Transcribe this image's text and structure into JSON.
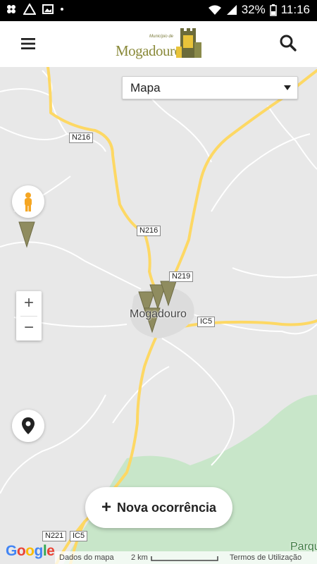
{
  "status_bar": {
    "battery": "32%",
    "time": "11:16",
    "left_icons": [
      "pinwheel-icon",
      "drive-icon",
      "gallery-icon",
      "dot-icon"
    ],
    "right_icons": [
      "wifi-icon",
      "signal-icon",
      "battery-icon"
    ]
  },
  "header": {
    "logo_small_text": "Município de",
    "logo_text": "Mogadouro",
    "menu_icon": "hamburger-icon",
    "search_icon": "search-icon"
  },
  "map_type": {
    "selected": "Mapa"
  },
  "map": {
    "place_label": "Mogadouro",
    "park_label": "Parqu",
    "roads": [
      "N216",
      "N216",
      "N219",
      "IC5",
      "N221",
      "IC5"
    ]
  },
  "controls": {
    "zoom_in": "+",
    "zoom_out": "−",
    "pegman_icon": "pegman-icon",
    "location_icon": "location-pin-icon"
  },
  "new_button": {
    "plus": "+",
    "label": "Nova ocorrência"
  },
  "attribution": {
    "google": [
      "G",
      "o",
      "o",
      "g",
      "l",
      "e"
    ],
    "map_data": "Dados do mapa",
    "scale": "2 km",
    "terms": "Termos de Utilização"
  },
  "colors": {
    "marker": "#8f8c5f",
    "road_major": "#fdd864",
    "park": "#c8e6c9",
    "land": "#e8e8e8"
  }
}
